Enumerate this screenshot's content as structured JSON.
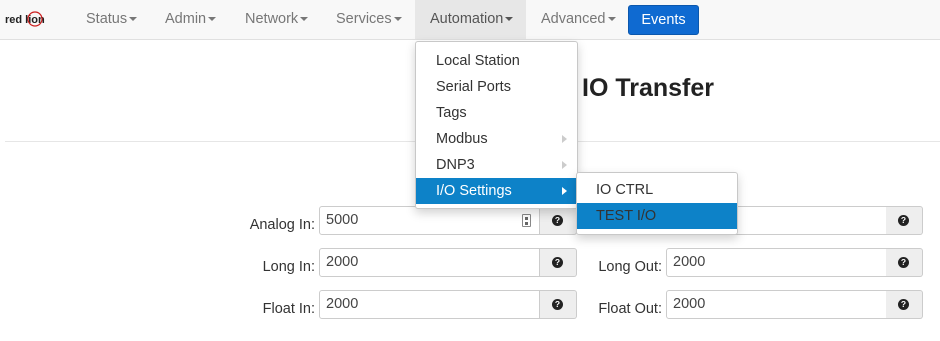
{
  "brand": {
    "logo_text": "red lion"
  },
  "nav": {
    "items": [
      {
        "label": "Status"
      },
      {
        "label": "Admin"
      },
      {
        "label": "Network"
      },
      {
        "label": "Services"
      },
      {
        "label": "Automation"
      },
      {
        "label": "Advanced"
      }
    ],
    "events_label": "Events"
  },
  "page": {
    "title": "IO Transfer"
  },
  "automation_menu": {
    "items": [
      {
        "label": "Local Station"
      },
      {
        "label": "Serial Ports"
      },
      {
        "label": "Tags"
      },
      {
        "label": "Modbus",
        "submenu": true
      },
      {
        "label": "DNP3",
        "submenu": true
      },
      {
        "label": "I/O Settings",
        "submenu": true,
        "active": true
      }
    ]
  },
  "io_settings_submenu": {
    "items": [
      {
        "label": "IO CTRL"
      },
      {
        "label": "TEST I/O",
        "active": true
      }
    ]
  },
  "form": {
    "analog_in": {
      "label": "Analog In:",
      "value": "5000"
    },
    "long_in": {
      "label": "Long In:",
      "value": "2000"
    },
    "long_out": {
      "label": "Long Out:",
      "value": "2000"
    },
    "float_in": {
      "label": "Float In:",
      "value": "2000"
    },
    "float_out": {
      "label": "Float Out:",
      "value": "2000"
    },
    "help_icon_glyph": "?"
  },
  "colors": {
    "accent": "#0d82c8",
    "events_button": "#0f6ad1",
    "navbar_bg": "#f8f8f8"
  }
}
